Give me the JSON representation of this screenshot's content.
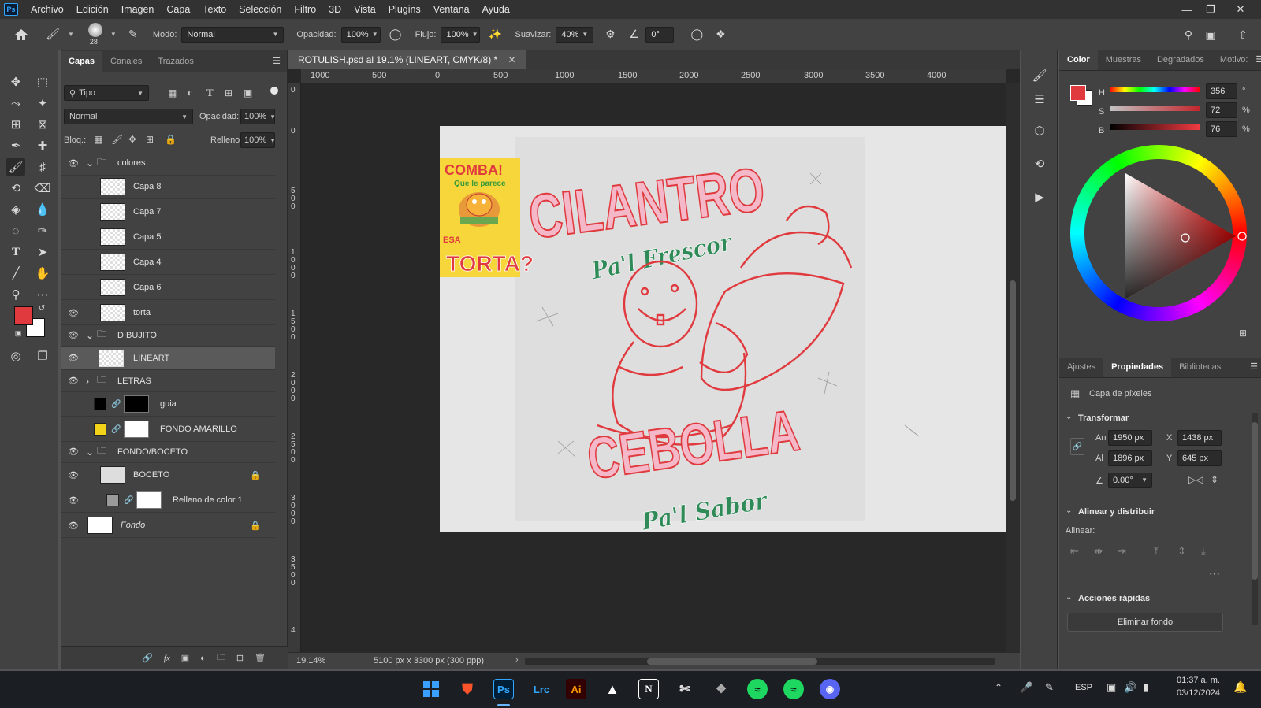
{
  "menu": [
    "Archivo",
    "Edición",
    "Imagen",
    "Capa",
    "Texto",
    "Selección",
    "Filtro",
    "3D",
    "Vista",
    "Plugins",
    "Ventana",
    "Ayuda"
  ],
  "app_logo": "Ps",
  "options": {
    "brush_size": "28",
    "mode_label": "Modo:",
    "mode_value": "Normal",
    "opacity_label": "Opacidad:",
    "opacity_value": "100%",
    "flow_label": "Flujo:",
    "flow_value": "100%",
    "smooth_label": "Suavizar:",
    "smooth_value": "40%",
    "angle_value": "0°"
  },
  "layers_panel": {
    "tabs": [
      "Capas",
      "Canales",
      "Trazados"
    ],
    "filter_label": "Tipo",
    "blend_mode": "Normal",
    "opacity_label": "Opacidad:",
    "opacity_value": "100%",
    "lock_label": "Bloq.:",
    "fill_label": "Relleno:",
    "fill_value": "100%",
    "layers": [
      {
        "name": "colores",
        "type": "group",
        "visible": true
      },
      {
        "name": "Capa 8",
        "type": "layer",
        "visible": false
      },
      {
        "name": "Capa 7",
        "type": "layer",
        "visible": false
      },
      {
        "name": "Capa 5",
        "type": "layer",
        "visible": false
      },
      {
        "name": "Capa 4",
        "type": "layer",
        "visible": false
      },
      {
        "name": "Capa 6",
        "type": "layer",
        "visible": false
      },
      {
        "name": "torta",
        "type": "layer",
        "visible": true
      },
      {
        "name": "DIBUJITO",
        "type": "group",
        "visible": true
      },
      {
        "name": "LINEART",
        "type": "layer",
        "visible": true,
        "selected": true
      },
      {
        "name": "LETRAS",
        "type": "group",
        "visible": true
      },
      {
        "name": "guia",
        "type": "masked",
        "visible": false
      },
      {
        "name": "FONDO AMARILLO",
        "type": "fill",
        "visible": false
      },
      {
        "name": "FONDO/BOCETO",
        "type": "group",
        "visible": true
      },
      {
        "name": "BOCETO",
        "type": "layer",
        "visible": true,
        "locked": true
      },
      {
        "name": "Relleno de color 1",
        "type": "fill",
        "visible": true
      },
      {
        "name": "Fondo",
        "type": "background",
        "visible": true,
        "locked": true
      }
    ]
  },
  "document": {
    "tab_title": "ROTULISH.psd al 19.1% (LINEART, CMYK/8) *",
    "ruler_h": [
      "1000",
      "500",
      "0",
      "500",
      "1000",
      "1500",
      "2000",
      "2500",
      "3000",
      "3500",
      "4000"
    ],
    "ruler_v": [
      "0",
      "0",
      "500",
      "1000",
      "1500",
      "2000",
      "2500",
      "3000",
      "3500",
      "4"
    ],
    "zoom": "19.14%",
    "doc_info": "5100 px x 3300 px (300 ppp)",
    "artwork": {
      "title_top": "CILANTRO",
      "subtitle_top": "Pa'l Frescor",
      "title_bottom": "CEBOLLA",
      "subtitle_bottom": "Pa'l Sabor",
      "ref_line1": "COMBA!",
      "ref_line2": "Que le parece",
      "ref_line3": "ESA",
      "ref_line4": "TORTA?"
    }
  },
  "color_panel": {
    "tabs": [
      "Color",
      "Muestras",
      "Degradados",
      "Motivo:"
    ],
    "h_label": "H",
    "h_value": "356",
    "h_unit": "°",
    "s_label": "S",
    "s_value": "72",
    "s_unit": "%",
    "b_label": "B",
    "b_value": "76",
    "b_unit": "%",
    "foreground": "#e03a3e",
    "background": "#ffffff"
  },
  "properties_panel": {
    "tabs": [
      "Ajustes",
      "Propiedades",
      "Bibliotecas"
    ],
    "layer_kind": "Capa de píxeles",
    "transform_title": "Transformar",
    "w_label": "An",
    "w_value": "1950 px",
    "x_label": "X",
    "x_value": "1438 px",
    "h_label": "Al",
    "h_value": "1896 px",
    "y_label": "Y",
    "y_value": "645 px",
    "angle_value": "0.00°",
    "align_title": "Alinear y distribuir",
    "align_label": "Alinear:",
    "quick_title": "Acciones rápidas",
    "remove_bg": "Eliminar fondo"
  },
  "taskbar": {
    "apps": [
      "Ps",
      "Lrc",
      "Ai"
    ],
    "lang": "ESP",
    "time": "01:37 a. m.",
    "date": "03/12/2024"
  }
}
